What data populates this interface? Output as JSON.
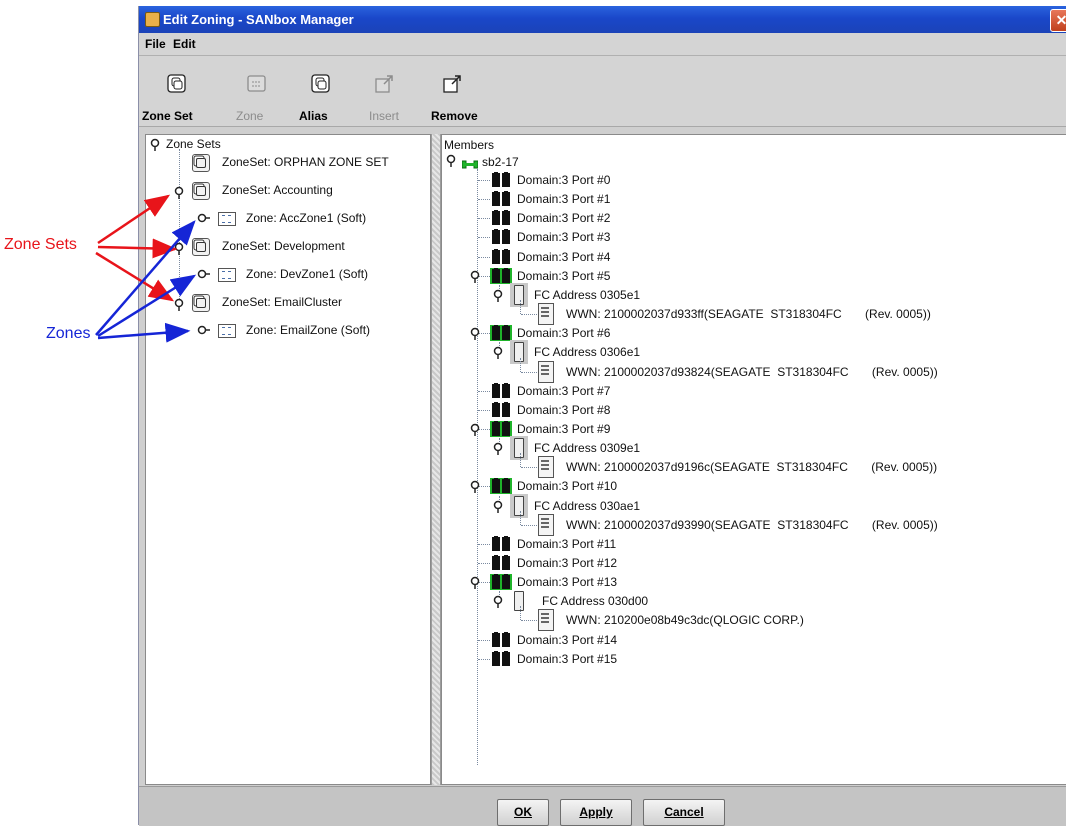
{
  "window": {
    "title": "Edit Zoning - SANbox Manager"
  },
  "menu": {
    "file": "File",
    "edit": "Edit"
  },
  "toolbar": [
    {
      "label": "Zone Set",
      "enabled": true,
      "icon": "zone-set-add-icon"
    },
    {
      "label": "Zone",
      "enabled": false,
      "icon": "zone-add-icon"
    },
    {
      "label": "Alias",
      "enabled": true,
      "icon": "alias-add-icon"
    },
    {
      "label": "Insert",
      "enabled": false,
      "icon": "insert-icon"
    },
    {
      "label": "Remove",
      "enabled": true,
      "icon": "remove-icon"
    }
  ],
  "left_tree": {
    "root": "Zone Sets",
    "items": [
      {
        "type": "zoneset",
        "label": "ZoneSet: ORPHAN ZONE SET",
        "expanded": false
      },
      {
        "type": "zoneset",
        "label": "ZoneSet: Accounting",
        "expanded": true
      },
      {
        "type": "zone",
        "label": "Zone: AccZone1 (Soft)"
      },
      {
        "type": "zoneset",
        "label": "ZoneSet: Development",
        "expanded": true
      },
      {
        "type": "zone",
        "label": "Zone: DevZone1 (Soft)"
      },
      {
        "type": "zoneset",
        "label": "ZoneSet: EmailCluster",
        "expanded": true
      },
      {
        "type": "zone",
        "label": "Zone: EmailZone (Soft)"
      }
    ]
  },
  "right_tree": {
    "header": "Members",
    "switch": "sb2-17",
    "rows": [
      {
        "level": 1,
        "type": "port",
        "label": "Domain:3 Port #0"
      },
      {
        "level": 1,
        "type": "port",
        "label": "Domain:3 Port #1"
      },
      {
        "level": 1,
        "type": "port",
        "label": "Domain:3 Port #2"
      },
      {
        "level": 1,
        "type": "port",
        "label": "Domain:3 Port #3"
      },
      {
        "level": 1,
        "type": "port",
        "label": "Domain:3 Port #4"
      },
      {
        "level": 1,
        "type": "port-active",
        "label": "Domain:3 Port #5"
      },
      {
        "level": 2,
        "type": "fc",
        "label": "FC Address 0305e1"
      },
      {
        "level": 3,
        "type": "wwn",
        "label": "WWN: 2100002037d933ff(SEAGATE  ST318304FC       (Rev. 0005))"
      },
      {
        "level": 1,
        "type": "port-active",
        "label": "Domain:3 Port #6"
      },
      {
        "level": 2,
        "type": "fc",
        "label": "FC Address 0306e1"
      },
      {
        "level": 3,
        "type": "wwn",
        "label": "WWN: 2100002037d93824(SEAGATE  ST318304FC       (Rev. 0005))"
      },
      {
        "level": 1,
        "type": "port",
        "label": "Domain:3 Port #7"
      },
      {
        "level": 1,
        "type": "port",
        "label": "Domain:3 Port #8"
      },
      {
        "level": 1,
        "type": "port-active",
        "label": "Domain:3 Port #9"
      },
      {
        "level": 2,
        "type": "fc",
        "label": "FC Address 0309e1"
      },
      {
        "level": 3,
        "type": "wwn",
        "label": "WWN: 2100002037d9196c(SEAGATE  ST318304FC       (Rev. 0005))"
      },
      {
        "level": 1,
        "type": "port-active",
        "label": "Domain:3 Port #10"
      },
      {
        "level": 2,
        "type": "fc",
        "label": "FC Address 030ae1"
      },
      {
        "level": 3,
        "type": "wwn",
        "label": "WWN: 2100002037d93990(SEAGATE  ST318304FC       (Rev. 0005))"
      },
      {
        "level": 1,
        "type": "port",
        "label": "Domain:3 Port #11"
      },
      {
        "level": 1,
        "type": "port",
        "label": "Domain:3 Port #12"
      },
      {
        "level": 1,
        "type": "port-active",
        "label": "Domain:3 Port #13"
      },
      {
        "level": 2,
        "type": "fc-plain",
        "label": "FC Address 030d00"
      },
      {
        "level": 3,
        "type": "wwn",
        "label": "WWN: 210200e08b49c3dc(QLOGIC CORP.)"
      },
      {
        "level": 1,
        "type": "port",
        "label": "Domain:3 Port #14"
      },
      {
        "level": 1,
        "type": "port",
        "label": "Domain:3 Port #15"
      }
    ]
  },
  "buttons": {
    "ok": "OK",
    "apply": "Apply",
    "cancel": "Cancel"
  },
  "annotations": {
    "zone_sets": "Zone Sets",
    "zones": "Zones",
    "zone_sets_color": "#e8141a",
    "zones_color": "#1525d6"
  }
}
